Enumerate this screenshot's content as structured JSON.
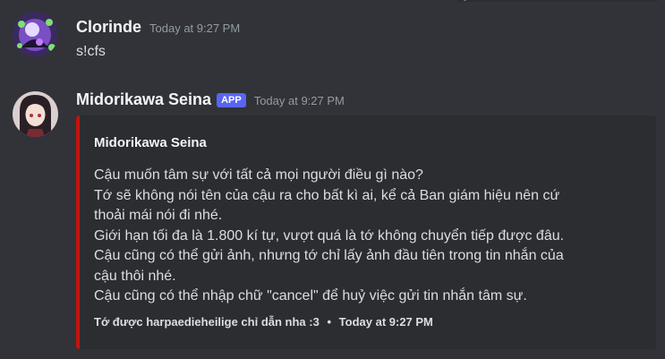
{
  "messages": [
    {
      "username": "Clorinde",
      "username_color": "#f2f3f5",
      "timestamp": "Today at 9:27 PM",
      "content": "s!cfs",
      "avatar_icon": "user-avatar"
    },
    {
      "username": "Midorikawa Seina",
      "badge": "APP",
      "timestamp": "Today at 9:27 PM",
      "avatar_icon": "bot-avatar",
      "embed": {
        "accent_color": "#c1140d",
        "author": "Midorikawa Seina",
        "description_lines": [
          "Cậu muốn tâm sự với tất cả mọi người điều gì nào?",
          "Tớ sẽ không nói tên của cậu ra cho bất kì ai, kể cả Ban giám hiệu nên cứ",
          "thoải mái nói đi nhé.",
          "Giới hạn tối đa là 1.800 kí tự, vượt quá là tớ không chuyển tiếp được đâu.",
          "Cậu cũng có thể gửi ảnh, nhưng tớ chỉ lấy ảnh đầu tiên trong tin nhắn của",
          "cậu thôi nhé.",
          "Cậu cũng có thể nhập chữ \"cancel\" để huỷ việc gửi tin nhắn tâm sự."
        ],
        "footer_text": "Tớ được harpaedieheilige chỉ dẫn nha :3",
        "footer_separator": "•",
        "footer_timestamp": "Today at 9:27 PM"
      }
    }
  ],
  "colors": {
    "background": "#313338",
    "embed_background": "#2b2d31",
    "badge": "#5865f2"
  }
}
